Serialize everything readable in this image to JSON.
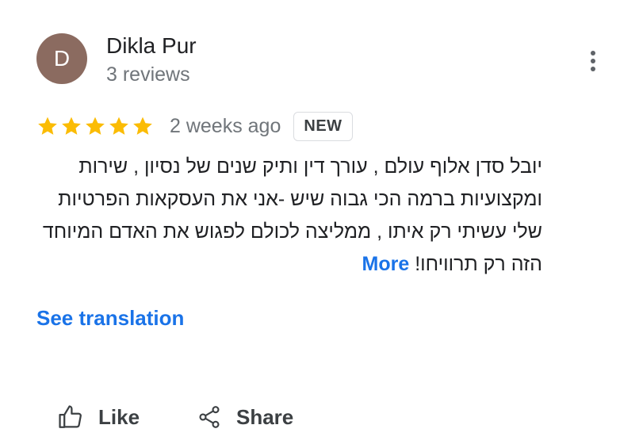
{
  "review": {
    "author": {
      "initial": "D",
      "name": "Dikla Pur",
      "reviews_count": "3 reviews",
      "avatar_color": "#8b6b60"
    },
    "rating": 5,
    "time_ago": "2 weeks ago",
    "badge": "NEW",
    "text": "יובל סדן אלוף עולם , עורך דין ותיק שנים של נסיון , שירות ומקצועיות ברמה הכי גבוה שיש -אני את העסקאות הפרטיות שלי עשיתי רק איתו , ממליצה לכולם לפגוש את האדם המיוחד הזה רק תרוויחו!",
    "more_label": "More",
    "see_translation": "See translation"
  },
  "actions": {
    "like_label": "Like",
    "share_label": "Share"
  },
  "icons": {
    "menu": "more-vert-icon",
    "star": "star-icon",
    "like": "thumbs-up-icon",
    "share": "share-icon"
  },
  "colors": {
    "star": "#fbbc04",
    "link": "#1a73e8",
    "secondary_text": "#70757a"
  }
}
